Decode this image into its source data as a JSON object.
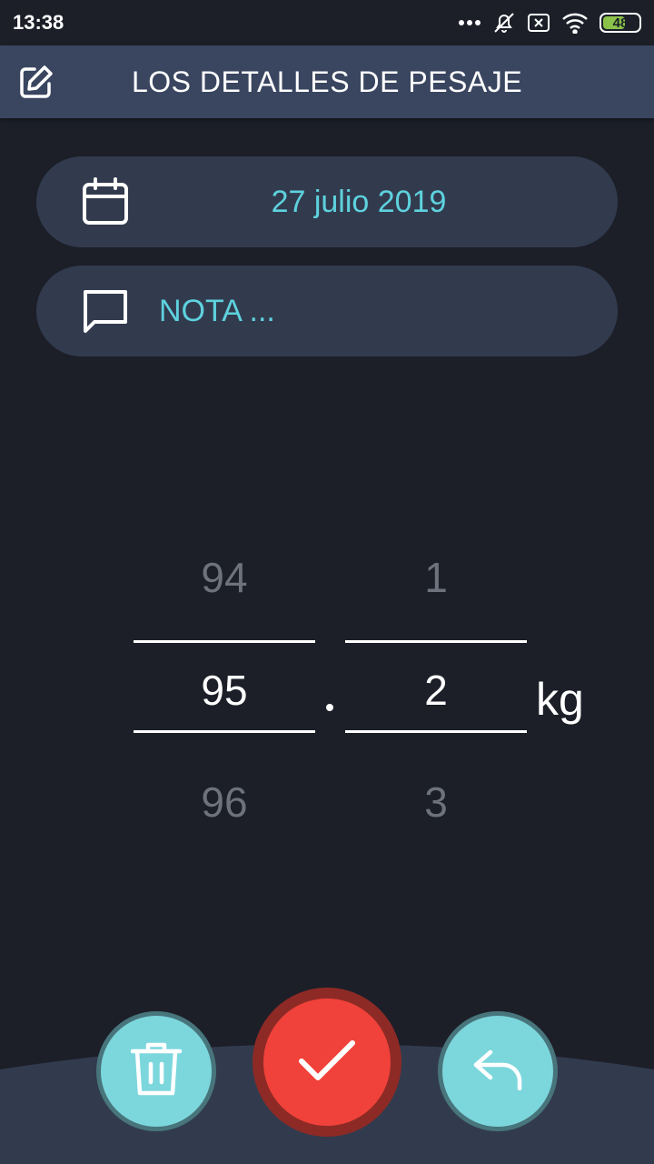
{
  "status_bar": {
    "time": "13:38",
    "battery_level": "48",
    "icons": [
      "more-dots-icon",
      "alarm-off-icon",
      "sim-x-icon",
      "wifi-icon",
      "battery-icon"
    ]
  },
  "app_bar": {
    "title": "LOS DETALLES DE PESAJE",
    "edit_icon": "edit-icon"
  },
  "date_field": {
    "value": "27 julio 2019",
    "icon": "calendar-icon"
  },
  "note_field": {
    "placeholder": "NOTA ...",
    "icon": "chat-bubble-icon"
  },
  "weight_picker": {
    "integer": {
      "prev": "94",
      "selected": "95",
      "next": "96"
    },
    "decimal": {
      "prev": "1",
      "selected": "2",
      "next": "3"
    },
    "unit": "kg"
  },
  "actions": {
    "delete_icon": "trash-icon",
    "confirm_icon": "check-icon",
    "back_icon": "reply-arrow-icon"
  },
  "colors": {
    "background": "#1c1f28",
    "app_bar": "#3a4660",
    "field_bg": "#323b4e",
    "accent_cyan": "#5ed2de",
    "confirm_red": "#f0423a",
    "fab_cyan": "#7cd7dd"
  }
}
